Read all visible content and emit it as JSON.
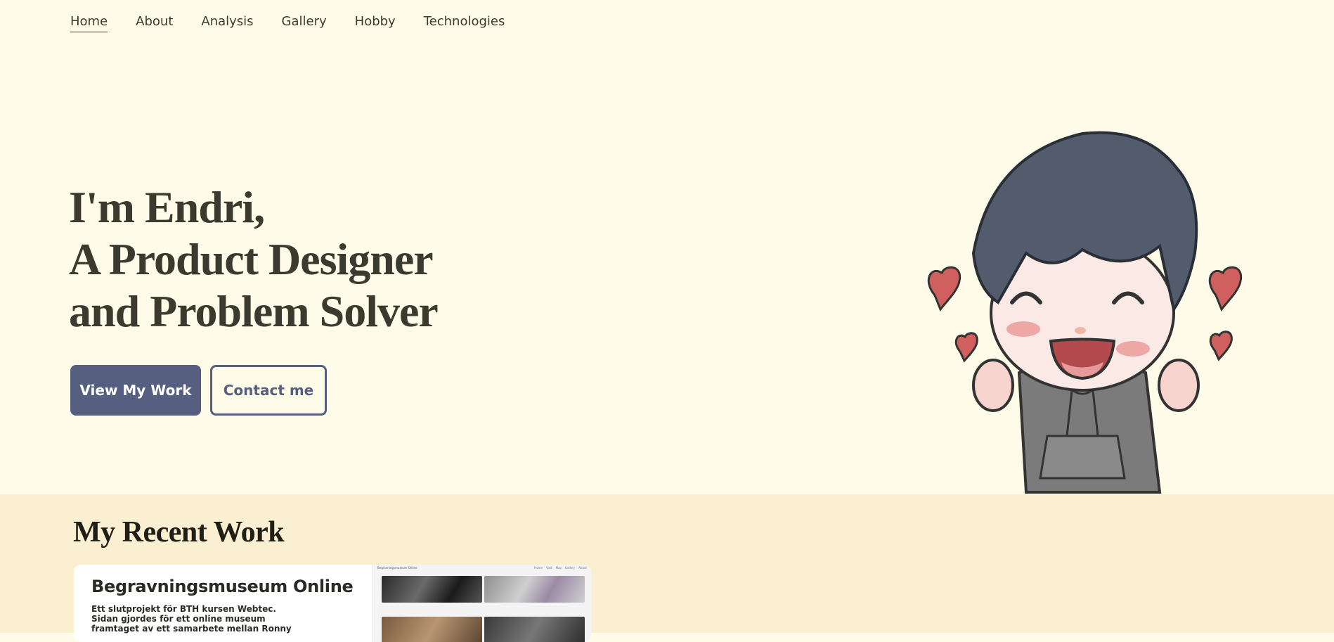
{
  "nav": {
    "items": [
      {
        "label": "Home",
        "active": true
      },
      {
        "label": "About"
      },
      {
        "label": "Analysis"
      },
      {
        "label": "Gallery"
      },
      {
        "label": "Hobby"
      },
      {
        "label": "Technologies"
      }
    ]
  },
  "hero": {
    "lines": [
      "I'm Endri,",
      "A Product Designer",
      "and Problem Solver"
    ],
    "primary_button": "View My Work",
    "secondary_button": "Contact me"
  },
  "recent": {
    "title": "My Recent Work",
    "card": {
      "title": "Begravningsmuseum Online",
      "desc_lines": [
        "Ett slutprojekt för BTH kursen Webtec.",
        "Sidan gjordes för ett online museum",
        "framtaget av ett samarbete mellan Ronny"
      ],
      "preview_brand": "Begravningsmuseum Online",
      "preview_nav": [
        "Home",
        "Visit",
        "Map",
        "Gallery",
        "About"
      ]
    }
  },
  "colors": {
    "background": "#fefce8",
    "section_background": "#faefd0",
    "accent": "#575f80",
    "text": "#3b3a2e"
  },
  "icons": [
    "chibi-boy-mascot",
    "heart-icon"
  ]
}
